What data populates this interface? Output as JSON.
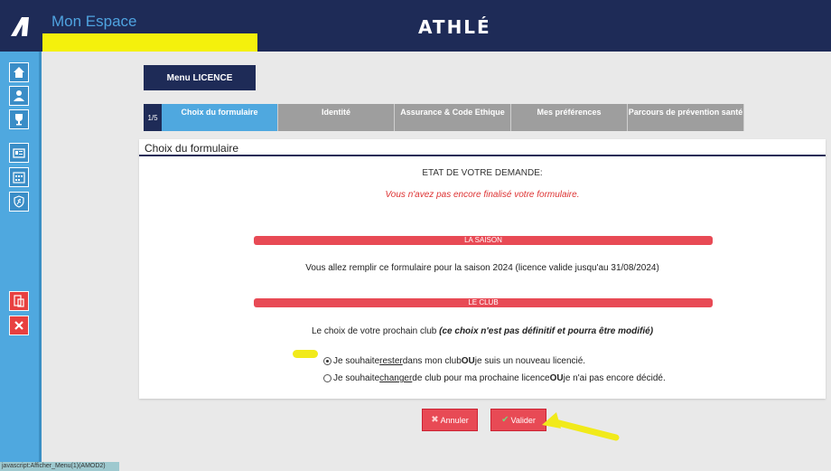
{
  "header": {
    "title": "Mon Espace",
    "brand": "ATHLÉ"
  },
  "sidebar": {
    "icons": [
      "home-icon",
      "user-icon",
      "trophy-icon",
      "id-card-icon",
      "calendar-icon",
      "runner-shield-icon",
      "mobile-icon",
      "close-icon"
    ]
  },
  "menu": {
    "label": "Menu LICENCE"
  },
  "tabs": {
    "step": "1/5",
    "items": [
      {
        "label": "Choix du formulaire"
      },
      {
        "label": "Identité"
      },
      {
        "label": "Assurance & Code Ethique"
      },
      {
        "label": "Mes préférences"
      },
      {
        "label": "Parcours de prévention santé"
      }
    ]
  },
  "panel": {
    "header": "Choix du formulaire",
    "etat": "ETAT DE VOTRE DEMANDE:",
    "not_final": "Vous n'avez pas encore finalisé votre formulaire.",
    "saison_title": "LA SAISON",
    "saison_text": "Vous allez remplir ce formulaire pour la saison 2024 (licence valide jusqu'au 31/08/2024)",
    "club_title": "LE CLUB",
    "club_text": "Le choix de votre prochain club",
    "club_note": "(ce choix n'est pas définitif et pourra être modifié)",
    "option1": {
      "pre": "Je souhaite ",
      "u": "rester",
      "mid": " dans mon club ",
      "b": "OU",
      "post": " je suis un nouveau licencié.",
      "checked": true
    },
    "option2": {
      "pre": "Je souhaite ",
      "u": "changer",
      "mid": " de club pour ma prochaine licence ",
      "b": "OU",
      "post": " je n'ai pas encore décidé.",
      "checked": false
    }
  },
  "actions": {
    "cancel": "Annuler",
    "validate": "Valider"
  },
  "statusbar": {
    "text": "javascript:Afficher_Menu(1)(AMOD2)"
  },
  "colors": {
    "navy": "#1e2b57",
    "blue": "#4fa8df",
    "red": "#e84a55",
    "highlight": "#f4f10c"
  }
}
